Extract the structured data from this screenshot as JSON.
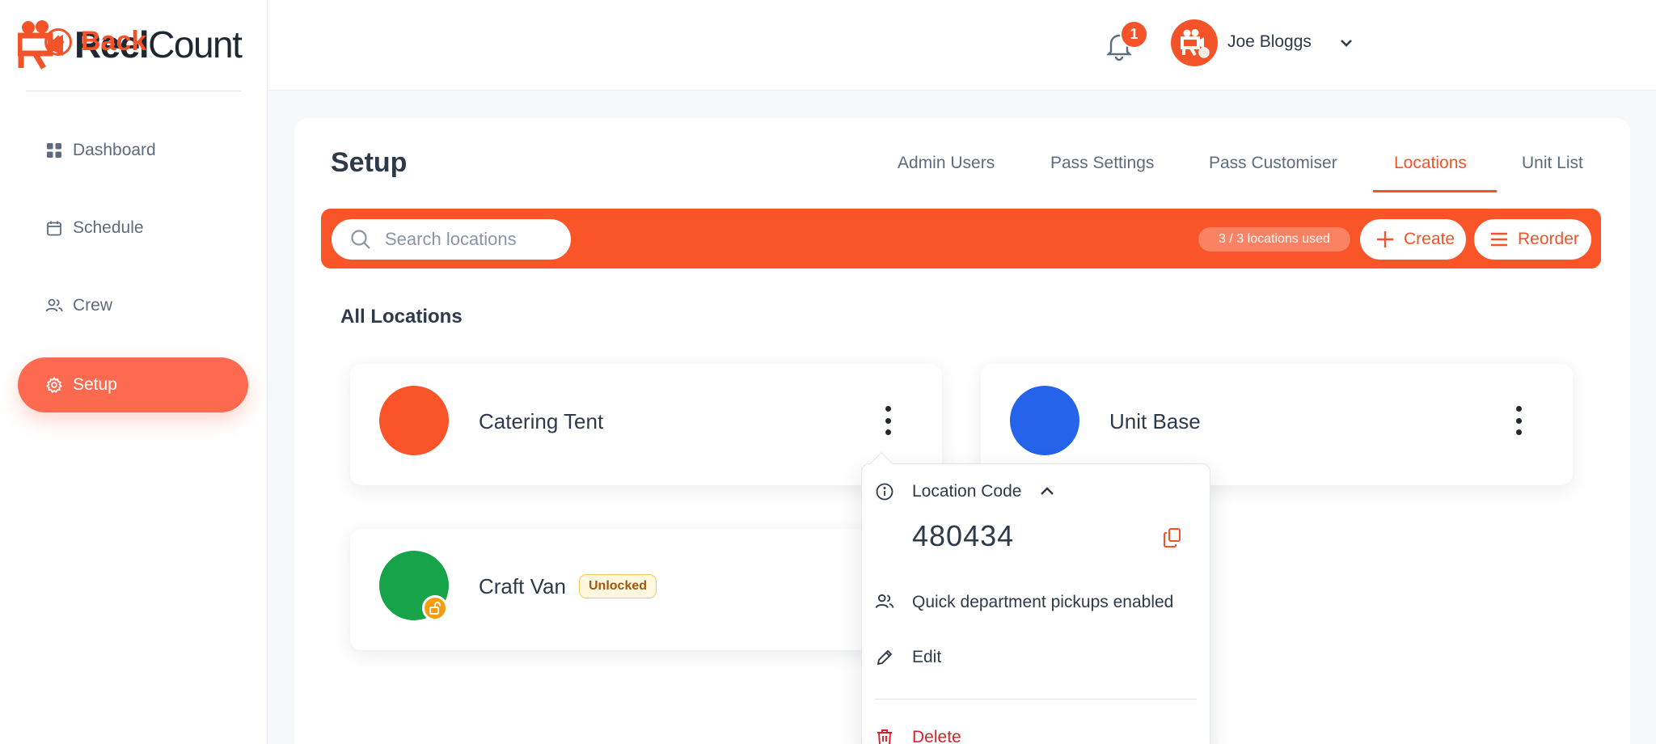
{
  "brand": {
    "name_bold": "Reel",
    "name_regular": "Count",
    "accent": "#f4532a"
  },
  "sidebar": {
    "items": [
      {
        "label": "Dashboard",
        "icon": "grid-icon",
        "active": false
      },
      {
        "label": "Schedule",
        "icon": "calendar-icon",
        "active": false
      },
      {
        "label": "Crew",
        "icon": "users-icon",
        "active": false
      },
      {
        "label": "Setup",
        "icon": "gear-icon",
        "active": true
      }
    ]
  },
  "header": {
    "back_label": "Back",
    "notification_count": "1",
    "user_name": "Joe Bloggs"
  },
  "page": {
    "title": "Setup",
    "tabs": [
      {
        "label": "Admin Users",
        "active": false
      },
      {
        "label": "Pass Settings",
        "active": false
      },
      {
        "label": "Pass Customiser",
        "active": false
      },
      {
        "label": "Locations",
        "active": true
      },
      {
        "label": "Unit List",
        "active": false
      }
    ]
  },
  "toolbar": {
    "search_placeholder": "Search locations",
    "usage": "3 / 3 locations used",
    "create_label": "Create",
    "reorder_label": "Reorder"
  },
  "locations": {
    "section_title": "All Locations",
    "items": [
      {
        "name": "Catering Tent",
        "color": "#fa5429"
      },
      {
        "name": "Unit Base",
        "color": "#2563eb"
      },
      {
        "name": "Craft Van",
        "color": "#16a34a",
        "badge": "Unlocked"
      }
    ]
  },
  "popover": {
    "code_label": "Location Code",
    "code_value": "480434",
    "pickups_label": "Quick department pickups enabled",
    "edit_label": "Edit",
    "delete_label": "Delete"
  }
}
